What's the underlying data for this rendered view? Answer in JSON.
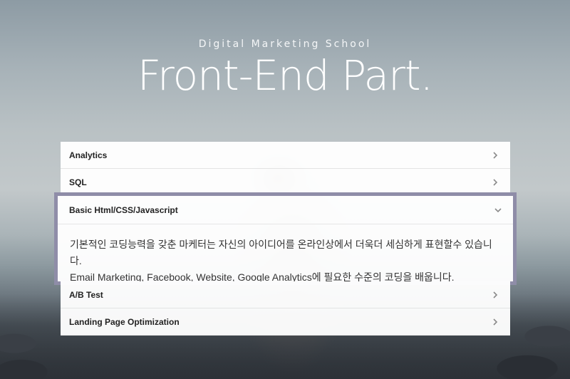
{
  "hero": {
    "subtitle": "Digital Marketing School",
    "title": "Front-End Part."
  },
  "accordion": {
    "items": [
      {
        "label": "Analytics",
        "icon": "chevron-right-icon",
        "expanded": false
      },
      {
        "label": "SQL",
        "icon": "chevron-right-icon",
        "expanded": false
      },
      {
        "label": "Basic Html/CSS/Javascript",
        "icon": "chevron-down-icon",
        "expanded": true,
        "content": [
          "기본적인 코딩능력을 갖춘 마케터는 자신의 아이디어를 온라인상에서 더욱더 세심하게 표현할수 있습니다.",
          "Email Marketing, Facebook, Website, Google Analytics에 필요한 수준의 코딩을 배웁니다."
        ]
      },
      {
        "label": "A/B Test",
        "icon": "chevron-right-icon",
        "expanded": false
      },
      {
        "label": "Landing Page Optimization",
        "icon": "chevron-right-icon",
        "expanded": false
      }
    ]
  },
  "colors": {
    "active_border": "#8f8da8",
    "panel_bg": "#ffffff",
    "title_text": "#ffffff"
  }
}
